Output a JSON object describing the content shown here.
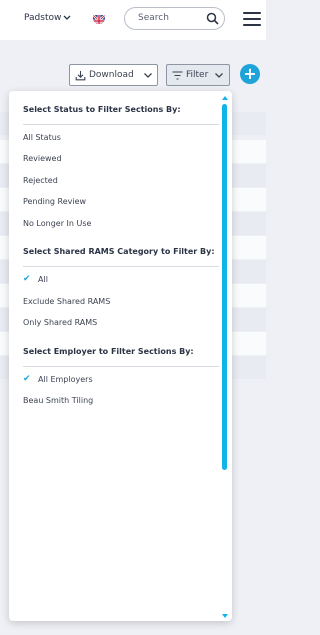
{
  "header": {
    "site_name": "Padstow",
    "search_placeholder": "Search"
  },
  "toolbar": {
    "download_label": "Download",
    "filter_label": "Filter",
    "add_label": "+"
  },
  "filter_menu": {
    "status_heading": "Select Status to Filter Sections By:",
    "status_options": [
      "All Status",
      "Reviewed",
      "Rejected",
      "Pending Review",
      "No Longer In Use"
    ],
    "rams_heading": "Select Shared RAMS Category to Filter By:",
    "rams_options": [
      "All",
      "Exclude Shared RAMS",
      "Only Shared RAMS"
    ],
    "rams_selected": "All",
    "employer_heading": "Select Employer to Filter Sections By:",
    "employer_options": [
      "All Employers",
      "Beau Smith Tiling"
    ],
    "employer_selected": "All Employers"
  },
  "colors": {
    "accent": "#10b4e6",
    "add_button": "#1ea4d8"
  }
}
